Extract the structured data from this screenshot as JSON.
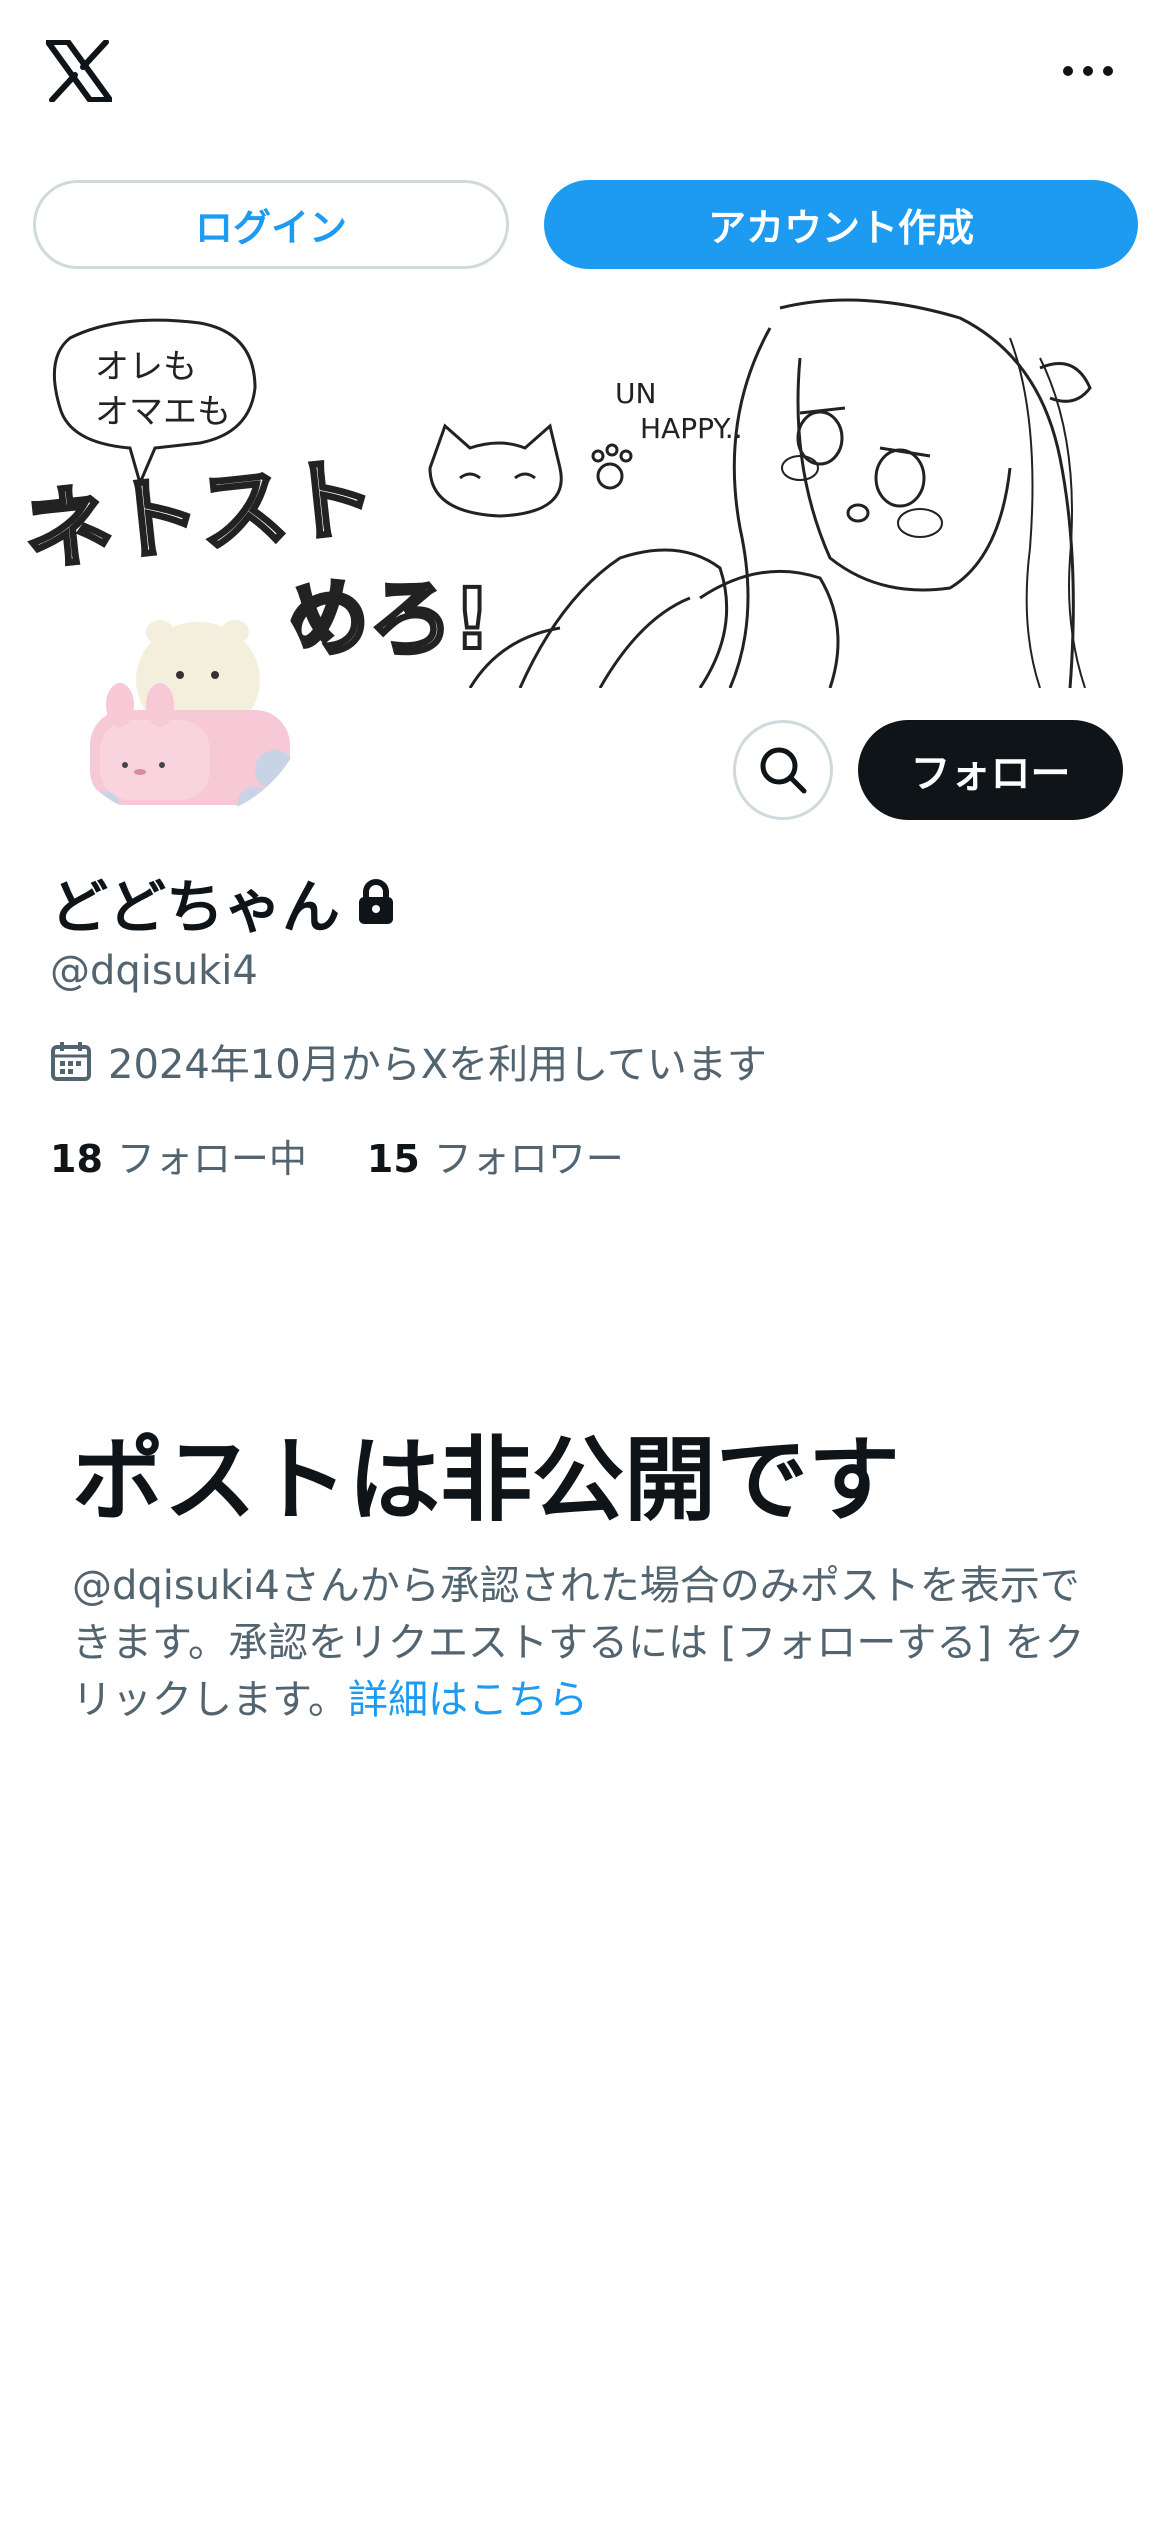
{
  "header": {
    "logo_icon": "x-logo-icon",
    "more_icon": "more-dots-icon",
    "login_label": "ログイン",
    "signup_label": "アカウント作成"
  },
  "banner": {
    "texts": [
      "オレも",
      "オマエも",
      "ネトスト",
      "めろ!",
      "UN",
      "HAPPY.."
    ]
  },
  "profile": {
    "display_name": "どどちゃん",
    "handle": "@dqisuki4",
    "joined": "2024年10月からXを利用しています",
    "following_count": "18",
    "following_label": "フォロー中",
    "followers_count": "15",
    "followers_label": "フォロワー"
  },
  "actions": {
    "search_icon": "search-icon",
    "follow_label": "フォロー"
  },
  "private_notice": {
    "title": "ポストは非公開です",
    "body": "@dqisuki4さんから承認された場合のみポストを表示できます。承認をリクエストするには [フォローする] をクリックします。",
    "link": "詳細はこちら"
  },
  "colors": {
    "accent": "#1d9bf0",
    "text_primary": "#0f1419",
    "text_secondary": "#536471",
    "border": "#cfd9de"
  }
}
